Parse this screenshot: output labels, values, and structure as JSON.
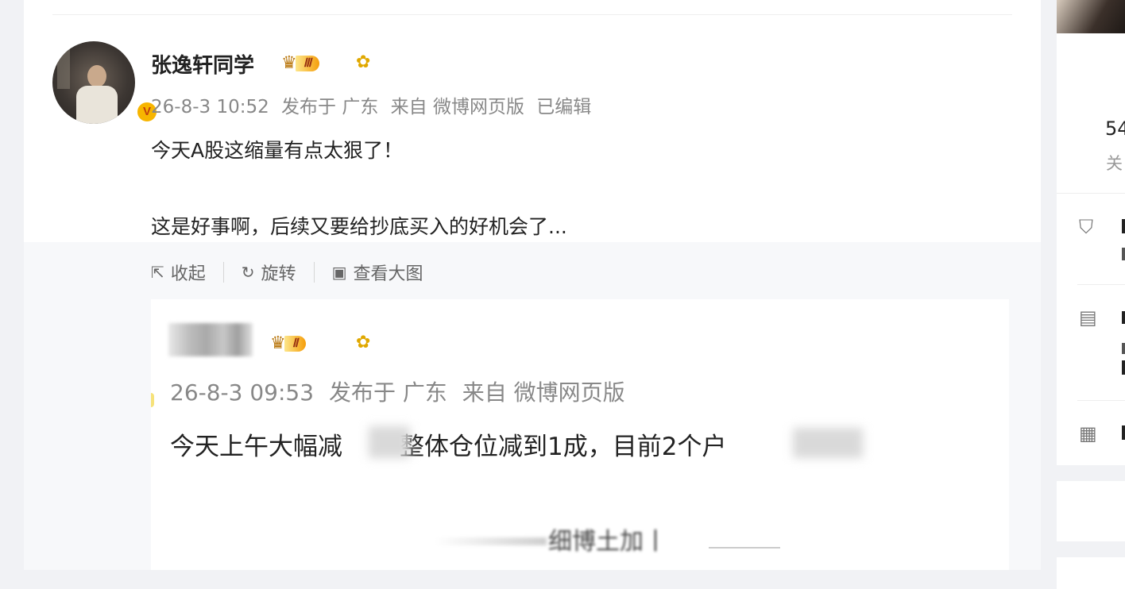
{
  "post": {
    "username": "张逸轩同学",
    "crown_level": "Ⅲ",
    "meta": {
      "time": "26-8-3 10:52",
      "location": "发布于 广东",
      "source": "来自 微博网页版",
      "edited": "已编辑"
    },
    "text_line1": "今天A股这缩量有点太狠了！",
    "text_line2": "这是好事啊，后续又要给抄底买入的好机会了..."
  },
  "media_actions": {
    "collapse": "收起",
    "rotate": "旋转",
    "view_large": "查看大图"
  },
  "embedded_screenshot": {
    "crown_level": "Ⅱ",
    "meta": {
      "time": "26-8-3 09:53",
      "location": "发布于 广东",
      "source": "来自 微博网页版"
    },
    "text_part1": "今天上午大幅减",
    "text_part2": "整体仓位减到1成，目前2个户",
    "watermark": "细博土加丨"
  },
  "sidebar": {
    "count": "54",
    "label": "关"
  }
}
